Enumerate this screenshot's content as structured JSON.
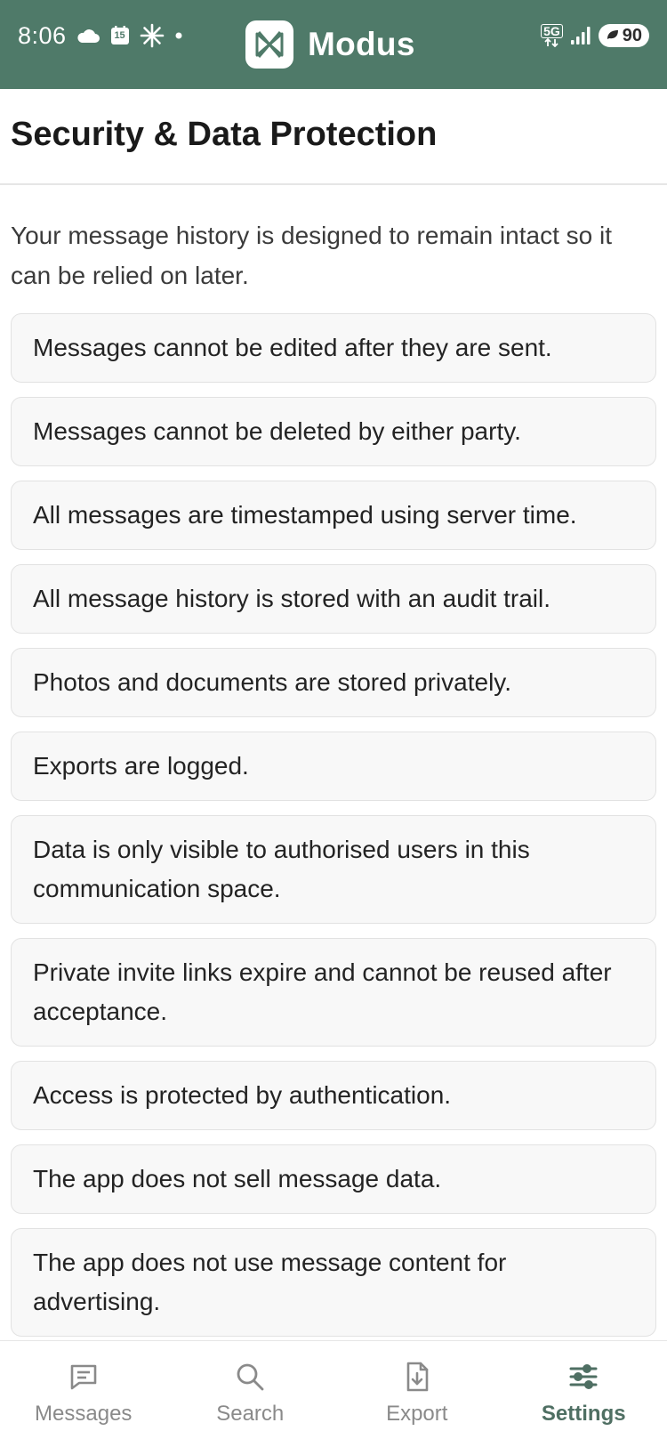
{
  "status_bar": {
    "time": "8:06",
    "calendar_day": "15",
    "network": "5G",
    "battery": "90"
  },
  "app": {
    "name": "Modus",
    "accent": "#4f7a69"
  },
  "page": {
    "title": "Security & Data Protection",
    "intro": "Your message history is designed to remain intact so it can be relied on later."
  },
  "items": [
    "Messages cannot be edited after they are sent.",
    "Messages cannot be deleted by either party.",
    "All messages are timestamped using server time.",
    "All message history is stored with an audit trail.",
    "Photos and documents are stored privately.",
    "Exports are logged.",
    "Data is only visible to authorised users in this communication space.",
    "Private invite links expire and cannot be reused after acceptance.",
    "Access is protected by authentication.",
    "The app does not sell message data.",
    "The app does not use message content for advertising."
  ],
  "nav": {
    "messages": "Messages",
    "search": "Search",
    "export": "Export",
    "settings": "Settings",
    "active": "settings"
  }
}
